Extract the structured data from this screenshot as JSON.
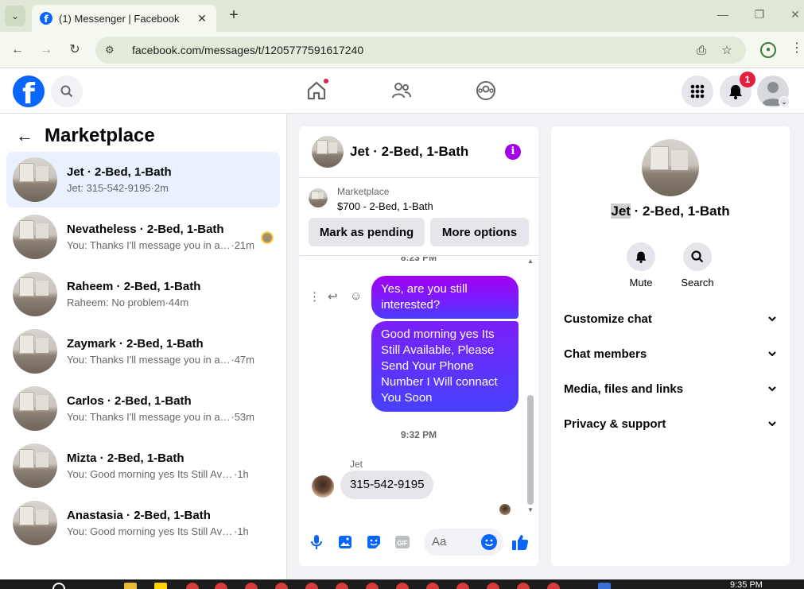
{
  "browser": {
    "tab_title": "(1) Messenger | Facebook",
    "tab_close": "✕",
    "new_tab": "+",
    "url": "facebook.com/messages/t/1205777591617240",
    "window_controls": {
      "minimize": "—",
      "maximize": "❐",
      "close": "✕"
    }
  },
  "fb_nav": {
    "logo": "f",
    "notification_count": "1",
    "icons": [
      "search-icon",
      "home-icon",
      "friends-icon",
      "groups-icon",
      "menu-grid-icon",
      "bell-icon",
      "account-avatar"
    ]
  },
  "left_panel": {
    "back": "←",
    "title": "Marketplace",
    "conversations": [
      {
        "name": "Jet · 2-Bed, 1-Bath",
        "last": "Jet: 315-542-9195",
        "time": "·2m",
        "active": true
      },
      {
        "name": "Nevatheless · 2-Bed, 1-Bath",
        "last": "You: Thanks I'll message you in a ...",
        "time": "·21m"
      },
      {
        "name": "Raheem · 2-Bed, 1-Bath",
        "last": "Raheem: No problem",
        "time": "·44m"
      },
      {
        "name": "Zaymark · 2-Bed, 1-Bath",
        "last": "You: Thanks I'll message you in a m...",
        "time": "·47m"
      },
      {
        "name": "Carlos · 2-Bed, 1-Bath",
        "last": "You: Thanks I'll message you in a m...",
        "time": "·53m"
      },
      {
        "name": "Mizta · 2-Bed, 1-Bath",
        "last": "You: Good morning yes Its Still Availa...",
        "time": "·1h"
      },
      {
        "name": "Anastasia · 2-Bed, 1-Bath",
        "last": "You: Good morning yes Its Still Availa...",
        "time": "·1h"
      }
    ]
  },
  "chat": {
    "title": "Jet · 2-Bed, 1-Bath",
    "info_icon": "i",
    "marketplace_label": "Marketplace",
    "listing": "$700 - 2-Bed, 1-Bath",
    "btn_pending": "Mark as pending",
    "btn_more": "More options",
    "ts_top": "8:23 PM",
    "msg_1": "Yes, are you still interested?",
    "msg_2": "Good morning yes Its Still Available, Please Send Your Phone Number I Will connact You Soon",
    "ts_mid": "9:32 PM",
    "sender": "Jet",
    "msg_3": "315-542-9195",
    "composer_placeholder": "Aa"
  },
  "right_panel": {
    "name_first": "Jet",
    "name_rest": " · 2-Bed, 1-Bath",
    "mute": "Mute",
    "search": "Search",
    "sections": [
      "Customize chat",
      "Chat members",
      "Media, files and links",
      "Privacy & support"
    ]
  },
  "taskbar": {
    "time": "9:35 PM"
  },
  "colors": {
    "fb_blue": "#0866ff",
    "bubble_purple": "#a100f2",
    "bubble_blue": "#4a3cfd",
    "badge_red": "#e41e3f"
  }
}
